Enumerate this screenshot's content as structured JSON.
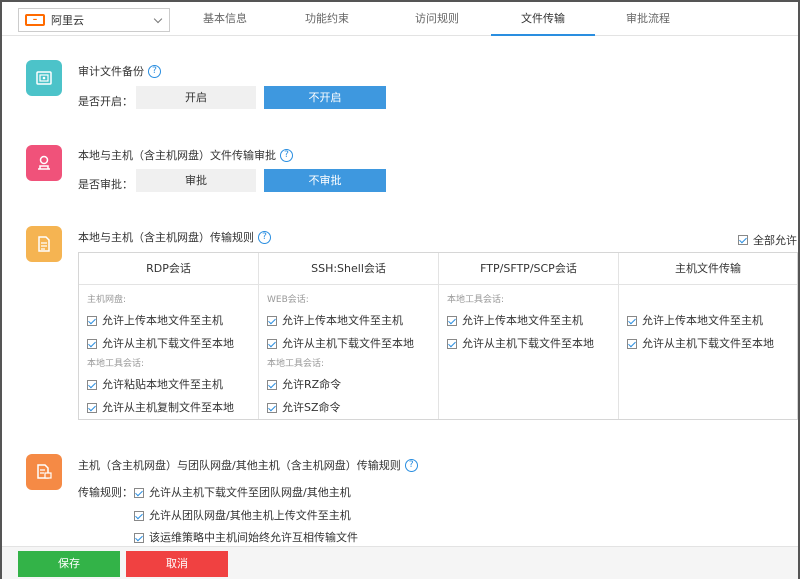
{
  "header": {
    "selector_label": "阿里云",
    "tabs": [
      "基本信息",
      "功能约束",
      "访问规则",
      "文件传输",
      "审批流程"
    ],
    "active_tab": "文件传输"
  },
  "audit": {
    "title": "审计文件备份",
    "row_label": "是否开启：",
    "on_label": "开启",
    "off_label": "不开启"
  },
  "approval": {
    "title": "本地与主机（含主机网盘）文件传输审批",
    "row_label": "是否审批：",
    "on_label": "审批",
    "off_label": "不审批"
  },
  "rules": {
    "title": "本地与主机（含主机网盘）传输规则",
    "allow_all": "全部允许",
    "columns": [
      {
        "head": "RDP会话",
        "groups": [
          {
            "label": "主机网盘:",
            "items": [
              "允许上传本地文件至主机",
              "允许从主机下载文件至本地"
            ]
          },
          {
            "label": "本地工具会话:",
            "items": [
              "允许粘贴本地文件至主机",
              "允许从主机复制文件至本地"
            ]
          }
        ]
      },
      {
        "head": "SSH:Shell会话",
        "groups": [
          {
            "label": "WEB会话:",
            "items": [
              "允许上传本地文件至主机",
              "允许从主机下载文件至本地"
            ]
          },
          {
            "label": "本地工具会话:",
            "items": [
              "允许RZ命令",
              "允许SZ命令"
            ]
          }
        ]
      },
      {
        "head": "FTP/SFTP/SCP会话",
        "groups": [
          {
            "label": "本地工具会话:",
            "items": [
              "允许上传本地文件至主机",
              "允许从主机下载文件至本地"
            ]
          }
        ]
      },
      {
        "head": "主机文件传输",
        "groups": [
          {
            "label": "",
            "items": [
              "允许上传本地文件至主机",
              "允许从主机下载文件至本地"
            ]
          }
        ]
      }
    ]
  },
  "transfer": {
    "title": "主机（含主机网盘）与团队网盘/其他主机（含主机网盘）传输规则",
    "row_label": "传输规则：",
    "items": [
      "允许从主机下载文件至团队网盘/其他主机",
      "允许从团队网盘/其他主机上传文件至主机",
      "该运维策略中主机间始终允许互相传输文件"
    ]
  },
  "footer": {
    "save_label": "保存",
    "cancel_label": "取消"
  },
  "colors": {
    "accent": "#3e98df",
    "save": "#33b348",
    "cancel": "#f04141",
    "icon_audit": "#4cc3c9",
    "icon_approval": "#f0527a",
    "icon_rules": "#f5b452",
    "icon_transfer": "#f58a45"
  }
}
